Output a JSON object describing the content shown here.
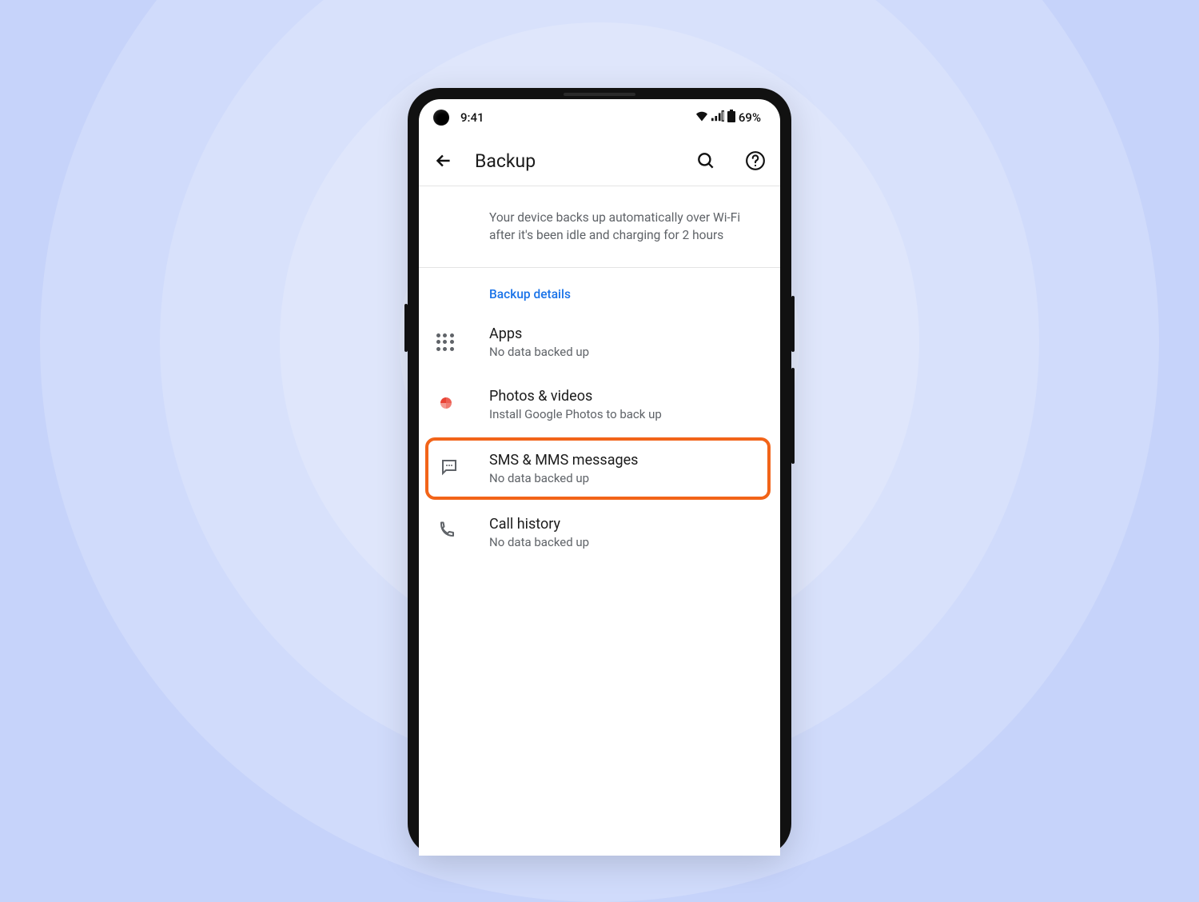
{
  "status_bar": {
    "time": "9:41",
    "battery": "69%"
  },
  "app_bar": {
    "title": "Backup"
  },
  "info_text": "Your device backs up automatically over Wi-Fi after it's been idle and charging for 2 hours",
  "section_header": "Backup details",
  "items": {
    "apps": {
      "title": "Apps",
      "subtitle": "No data backed up"
    },
    "photos": {
      "title": "Photos & videos",
      "subtitle": "Install Google Photos to back up"
    },
    "sms": {
      "title": "SMS & MMS messages",
      "subtitle": "No data backed up"
    },
    "calls": {
      "title": "Call history",
      "subtitle": "No data backed up"
    }
  },
  "highlight_color": "#f26419"
}
